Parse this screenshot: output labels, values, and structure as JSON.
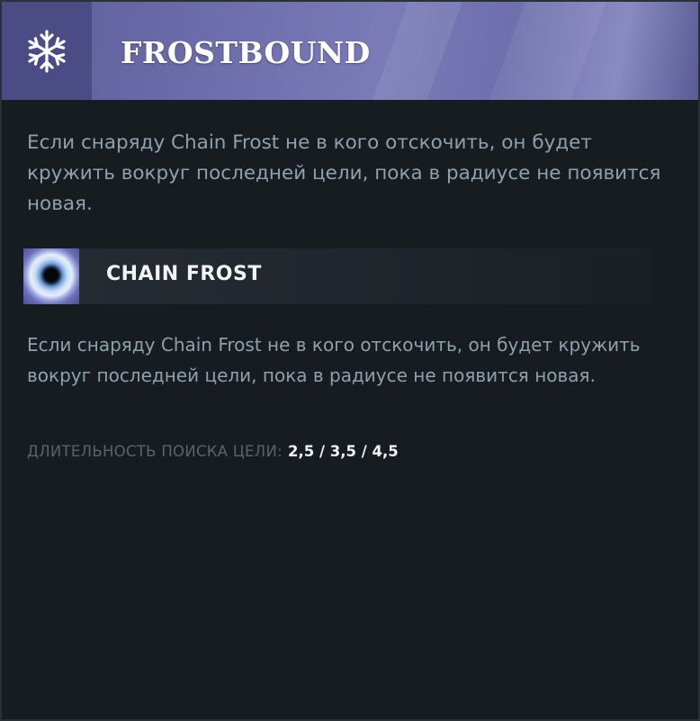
{
  "talent": {
    "icon": "snowflake-icon",
    "title": "FROSTBOUND",
    "description": "Если снаряду Chain Frost не в кого отскочить, он будет кружить вокруг последней цели, пока в радиусе не появится новая."
  },
  "ability": {
    "icon": "chain-frost-icon",
    "title": "CHAIN FROST",
    "description": "Если снаряду Chain Frost не в кого отскочить, он будет кружить вокруг последней цели, пока в радиусе не появится новая.",
    "stat_label": "ДЛИТЕЛЬНОСТЬ ПОИСКА ЦЕЛИ:",
    "stat_value": "2,5 / 3,5 / 4,5"
  },
  "colors": {
    "header_bg": "#6a6aa8",
    "header_icon_bg": "#4b4c86",
    "panel_bg": "#171c21",
    "description_text": "#8fa0ad",
    "stat_label_text": "#59636d",
    "stat_value_text": "#f2f4f6"
  }
}
